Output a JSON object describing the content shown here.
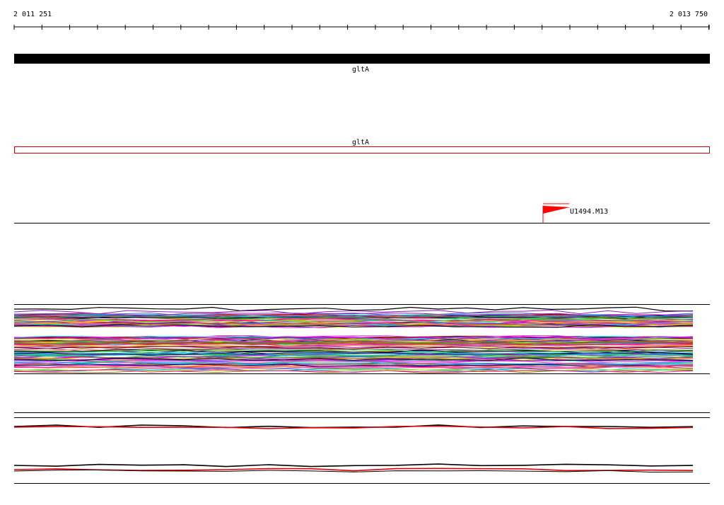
{
  "ruler": {
    "start_label": "2 011 251",
    "end_label": "2 013 750"
  },
  "gene_track": {
    "label": "gltA",
    "color": "#000000"
  },
  "cds_track": {
    "label": "gltA",
    "color": "#cc0000"
  },
  "feature_track": {
    "marker_label": "U1494.M13",
    "marker_color": "#ff0000"
  },
  "colors": {
    "background": "#ffffff",
    "axis": "#000000",
    "palette": [
      "#e6194b",
      "#3cb44b",
      "#4363d8",
      "#f58231",
      "#911eb4",
      "#46f0f0",
      "#f032e6",
      "#bcf60c",
      "#008080",
      "#9a6324",
      "#800000",
      "#808000",
      "#000075",
      "#ff00ff",
      "#00bfff",
      "#ffd700",
      "#ff1493",
      "#32cd32",
      "#8a2be2",
      "#000000"
    ]
  }
}
